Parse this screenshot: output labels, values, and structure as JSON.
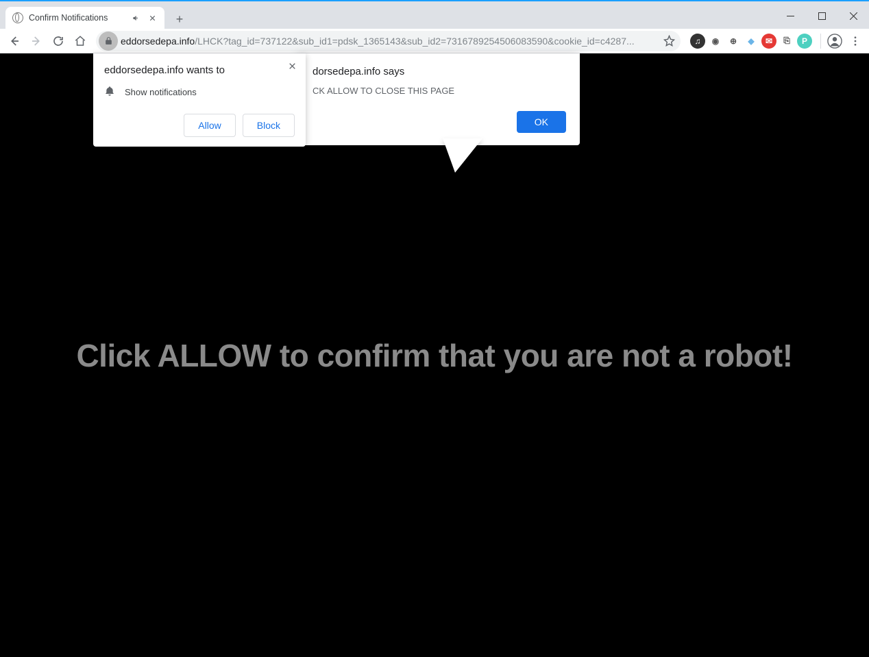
{
  "tab": {
    "title": "Confirm Notifications"
  },
  "url": {
    "host": "eddorsedepa.info",
    "path": "/LHCK?tag_id=737122&sub_id1=pdsk_1365143&sub_id2=7316789254506083590&cookie_id=c4287..."
  },
  "page": {
    "headline": "Click ALLOW to confirm that you are not a robot!"
  },
  "notif_popup": {
    "title": "eddorsedepa.info wants to",
    "permission_label": "Show notifications",
    "allow_label": "Allow",
    "block_label": "Block"
  },
  "alert": {
    "title": "dorsedepa.info says",
    "body": "CK ALLOW TO CLOSE THIS PAGE",
    "ok_label": "OK"
  },
  "ext_icons": [
    {
      "name": "music-icon",
      "bg": "#333",
      "fg": "#fff",
      "glyph": "♫"
    },
    {
      "name": "camera-icon",
      "bg": "transparent",
      "fg": "#555",
      "glyph": "◉"
    },
    {
      "name": "zoom-icon",
      "bg": "transparent",
      "fg": "#555",
      "glyph": "⊕"
    },
    {
      "name": "crystal-icon",
      "bg": "transparent",
      "fg": "#6bb5e8",
      "glyph": "◆"
    },
    {
      "name": "mail-icon",
      "bg": "#e53935",
      "fg": "#fff",
      "glyph": "✉"
    },
    {
      "name": "clip-icon",
      "bg": "transparent",
      "fg": "#555",
      "glyph": "⎘"
    },
    {
      "name": "pdf-icon",
      "bg": "#4dd0c0",
      "fg": "#fff",
      "glyph": "P"
    }
  ]
}
